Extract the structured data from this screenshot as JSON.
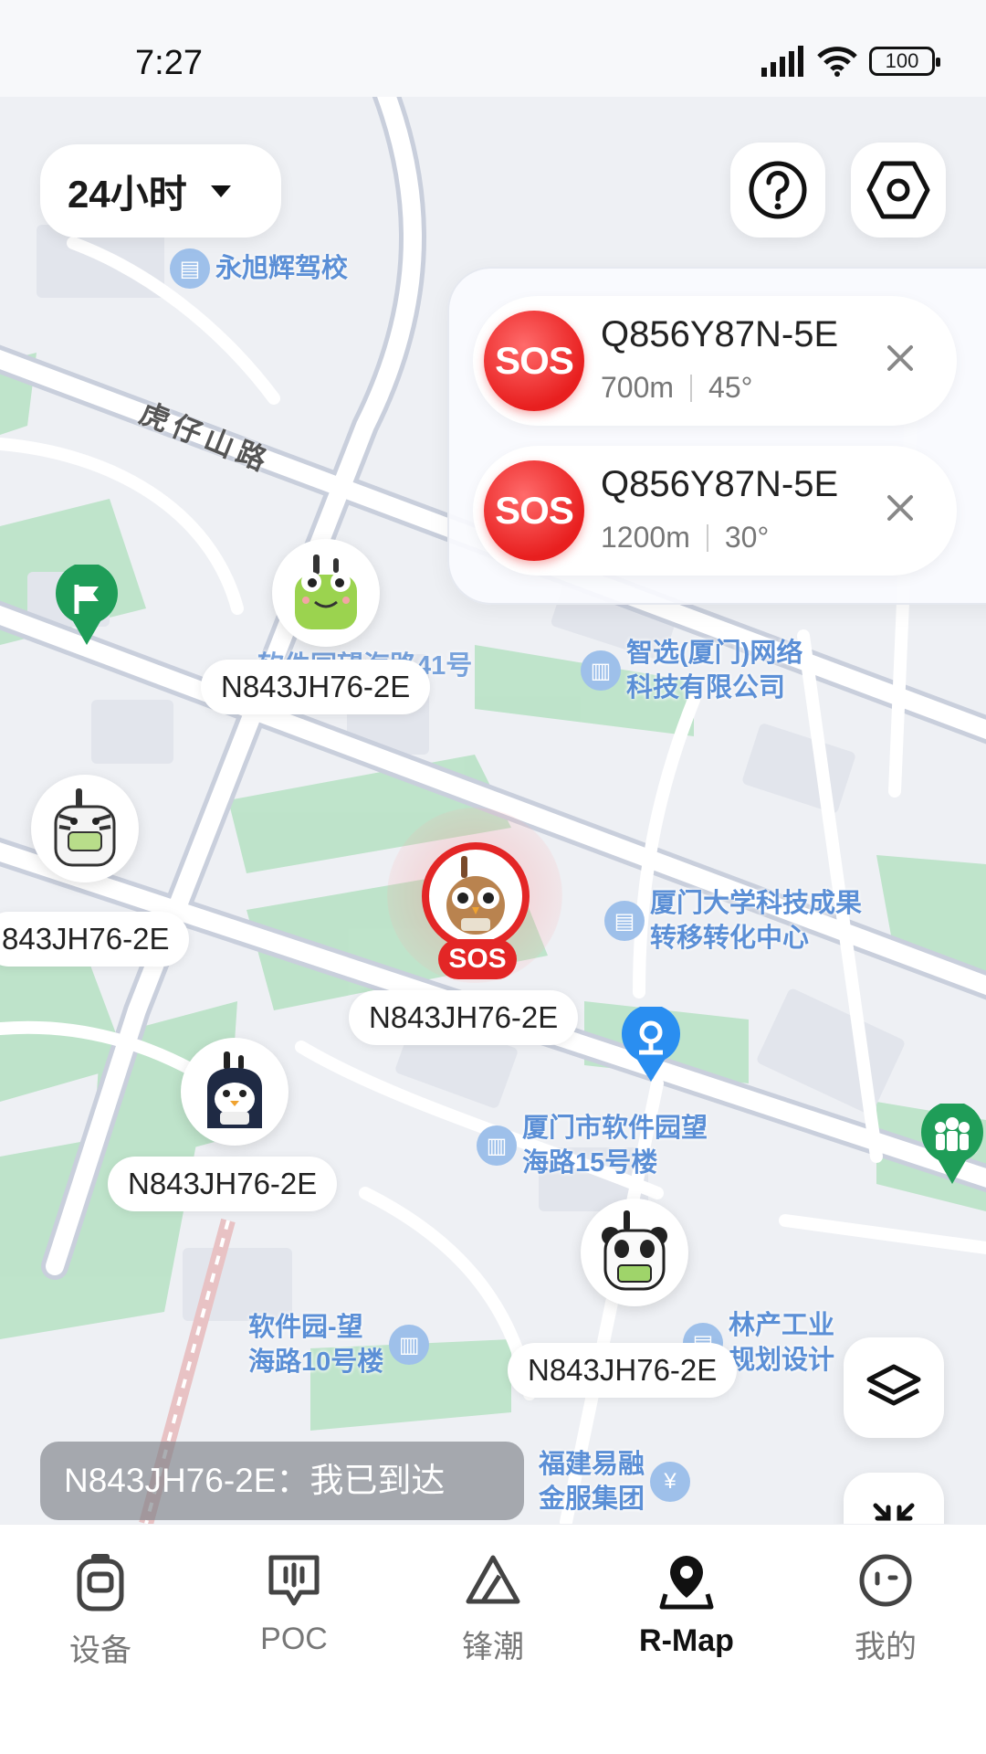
{
  "status_bar": {
    "time": "7:27",
    "battery": "100"
  },
  "map": {
    "time_filter": {
      "value": "24小时"
    },
    "road_label": "虎仔山路",
    "pois": [
      {
        "name": "永旭辉驾校"
      },
      {
        "name": "智选(厦门)网络\n科技有限公司"
      },
      {
        "name": "厦门大学科技成果\n转移转化中心"
      },
      {
        "name": "厦门市软件园望\n海路15号楼"
      },
      {
        "name": "软件园-望\n海路10号楼"
      },
      {
        "name": "福建易融\n金服集团"
      },
      {
        "name": "林产工业\n规划设计"
      },
      {
        "name": "软件园望海路41号"
      }
    ],
    "sos_alerts": [
      {
        "device": "Q856Y87N-5E",
        "distance": "700m",
        "bearing": "45°",
        "badge": "SOS"
      },
      {
        "device": "Q856Y87N-5E",
        "distance": "1200m",
        "bearing": "30°",
        "badge": "SOS"
      }
    ],
    "devices": [
      {
        "label": "N843JH76-2E",
        "avatar": "frog-walkie-icon"
      },
      {
        "label": "843JH76-2E",
        "avatar": "zebra-walkie-icon"
      },
      {
        "label": "N843JH76-2E",
        "avatar": "owl-walkie-icon",
        "status": "SOS"
      },
      {
        "label": "N843JH76-2E",
        "avatar": "penguin-walkie-icon"
      },
      {
        "label": "N843JH76-2E",
        "avatar": "panda-walkie-icon"
      }
    ],
    "toast": "N843JH76-2E：我已到达"
  },
  "tabs": [
    {
      "label": "设备",
      "icon": "device-icon"
    },
    {
      "label": "POC",
      "icon": "poc-icon"
    },
    {
      "label": "锋潮",
      "icon": "trend-icon"
    },
    {
      "label": "R-Map",
      "icon": "map-pin-icon",
      "active": true
    },
    {
      "label": "我的",
      "icon": "profile-icon"
    }
  ],
  "colors": {
    "sos_red": "#e32626",
    "park_green": "#a8dcb8",
    "water_blue": "#5b8fd6",
    "road": "#ffffff",
    "map_bg": "#eef0f4"
  }
}
